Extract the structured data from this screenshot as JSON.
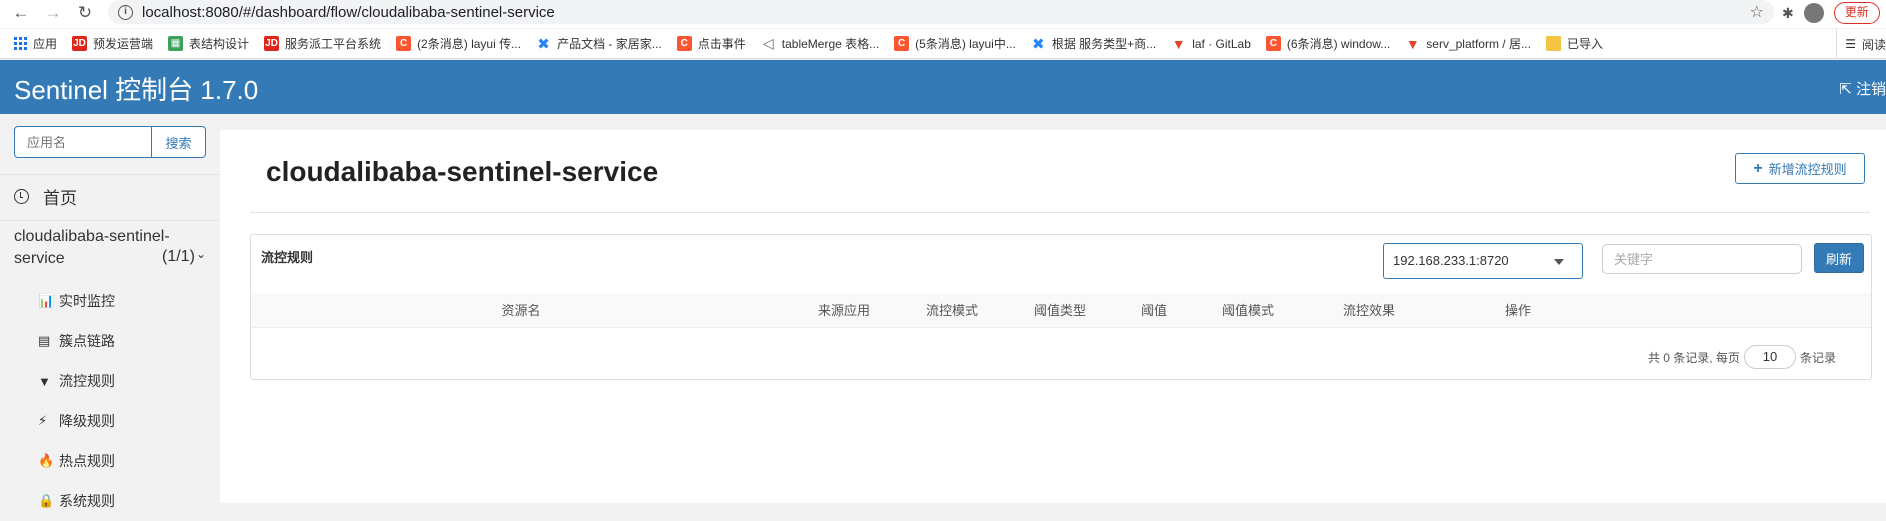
{
  "browser": {
    "url": "localhost:8080/#/dashboard/flow/cloudalibaba-sentinel-service",
    "update_label": "更新",
    "bookmarks": [
      {
        "label": "应用",
        "icon": "apps-grid-icon"
      },
      {
        "label": "预发运营端",
        "icon": "jd-icon"
      },
      {
        "label": "表结构设计",
        "icon": "sheet-icon"
      },
      {
        "label": "服务派工平台系统",
        "icon": "jd-icon"
      },
      {
        "label": "(2条消息) layui 传...",
        "icon": "csdn-icon"
      },
      {
        "label": "产品文档 - 家居家...",
        "icon": "confluence-icon"
      },
      {
        "label": "点击事件",
        "icon": "csdn-icon"
      },
      {
        "label": "tableMerge 表格...",
        "icon": "tablemerge-icon"
      },
      {
        "label": "(5条消息) layui中...",
        "icon": "csdn-icon"
      },
      {
        "label": "根据 服务类型+商...",
        "icon": "confluence-icon"
      },
      {
        "label": "laf · GitLab",
        "icon": "gitlab-icon"
      },
      {
        "label": "(6条消息) window...",
        "icon": "csdn-icon"
      },
      {
        "label": "serv_platform / 居...",
        "icon": "gitlab-icon"
      },
      {
        "label": "已导入",
        "icon": "folder-icon"
      }
    ],
    "reading_list": "阅读"
  },
  "header": {
    "brand": "Sentinel 控制台 1.7.0",
    "logout": "注销"
  },
  "sidebar": {
    "search_placeholder": "应用名",
    "search_button": "搜索",
    "home": "首页",
    "app_name": "cloudalibaba-sentinel-service",
    "app_count": "(1/1)",
    "items": [
      {
        "label": "实时监控",
        "icon": "bar-chart-icon"
      },
      {
        "label": "簇点链路",
        "icon": "list-icon"
      },
      {
        "label": "流控规则",
        "icon": "filter-icon"
      },
      {
        "label": "降级规则",
        "icon": "flash-icon"
      },
      {
        "label": "热点规则",
        "icon": "fire-icon"
      },
      {
        "label": "系统规则",
        "icon": "lock-icon"
      }
    ]
  },
  "main": {
    "title": "cloudalibaba-sentinel-service",
    "add_button": "新增流控规则",
    "panel_title": "流控规则",
    "machine": "192.168.233.1:8720",
    "keyword_placeholder": "关键字",
    "refresh": "刷新",
    "columns": [
      "资源名",
      "来源应用",
      "流控模式",
      "阈值类型",
      "阈值",
      "阈值模式",
      "流控效果",
      "操作"
    ],
    "pager": {
      "prefix": "共 0 条记录, 每页",
      "page_size": "10",
      "suffix": "条记录"
    }
  }
}
